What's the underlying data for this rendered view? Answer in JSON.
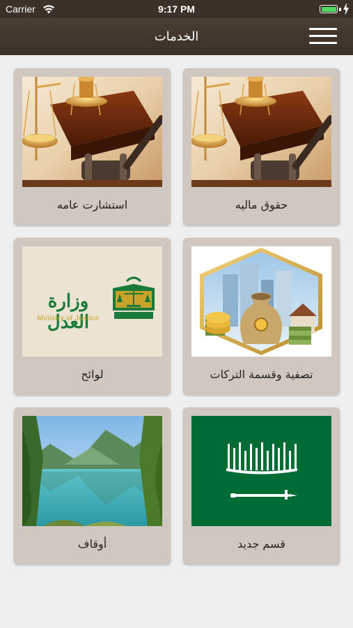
{
  "status_bar": {
    "carrier": "Carrier",
    "time": "9:17 PM",
    "battery_color": "#4cd964"
  },
  "nav": {
    "title": "الخدمات",
    "menu_icon": "hamburger-menu-icon"
  },
  "tiles": [
    {
      "label": "حقوق ماليه",
      "image": "scales-of-justice-gavel"
    },
    {
      "label": "استشارت عامه",
      "image": "scales-of-justice-gavel"
    },
    {
      "label": "تصفية وقسمة التركات",
      "image": "money-bag-buildings"
    },
    {
      "label": "لوائح",
      "image": "ministry-of-justice-logo"
    },
    {
      "label": "قسم جديد",
      "image": "saudi-flag"
    },
    {
      "label": "أوقاف",
      "image": "mountain-lake"
    }
  ],
  "logo_text": {
    "arabic": "وزارة العدل",
    "english": "Ministry of Justice"
  },
  "colors": {
    "header": "#3c3128",
    "tile_bg": "#d0c7c0",
    "page_bg": "#efefef",
    "logo_green": "#1a7a3a",
    "logo_gold": "#c9a227",
    "flag_green": "#006c35"
  }
}
